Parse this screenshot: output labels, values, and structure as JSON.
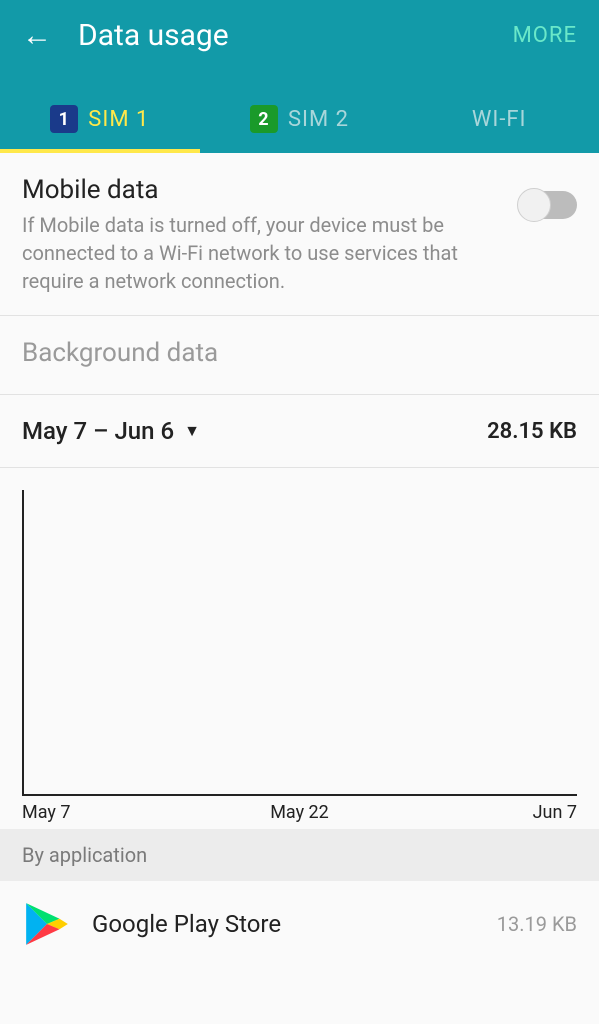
{
  "header": {
    "title": "Data usage",
    "more": "MORE"
  },
  "tabs": [
    {
      "label": "SIM 1",
      "badge": "1"
    },
    {
      "label": "SIM 2",
      "badge": "2"
    },
    {
      "label": "WI-FI"
    }
  ],
  "mobile_data": {
    "title": "Mobile data",
    "subtitle": "If Mobile data is turned off, your device must be connected to a Wi-Fi network to use services that require a network connection."
  },
  "background_data": {
    "title": "Background data"
  },
  "period": {
    "range": "May 7 – Jun 6",
    "total": "28.15 KB"
  },
  "chart_data": {
    "type": "line",
    "x_labels": [
      "May 7",
      "May 22",
      "Jun 7"
    ],
    "values": [],
    "title": "",
    "xlabel": "",
    "ylabel": "",
    "ylim": [
      0,
      0
    ]
  },
  "section_by_app": "By application",
  "apps": [
    {
      "name": "Google Play Store",
      "usage": "13.19 KB"
    }
  ]
}
